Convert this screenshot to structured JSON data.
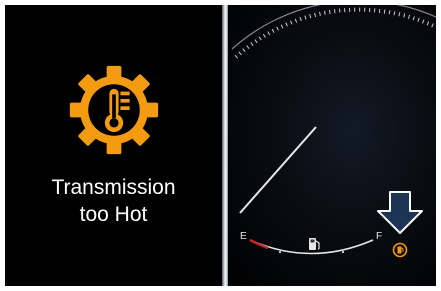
{
  "warning": {
    "icon": "transmission-temperature-gear-icon",
    "line1": "Transmission",
    "line2": "too Hot"
  },
  "fuel_gauge": {
    "empty_label": "E",
    "full_label": "F",
    "pump_icon": "fuel-pump-icon",
    "low_fuel_icon": "low-fuel-warning-icon",
    "indicator_icon": "down-arrow-icon"
  },
  "colors": {
    "warning_amber": "#f39c12",
    "background": "#000000",
    "text": "#ffffff",
    "fuel_low_red": "#c0282a"
  }
}
